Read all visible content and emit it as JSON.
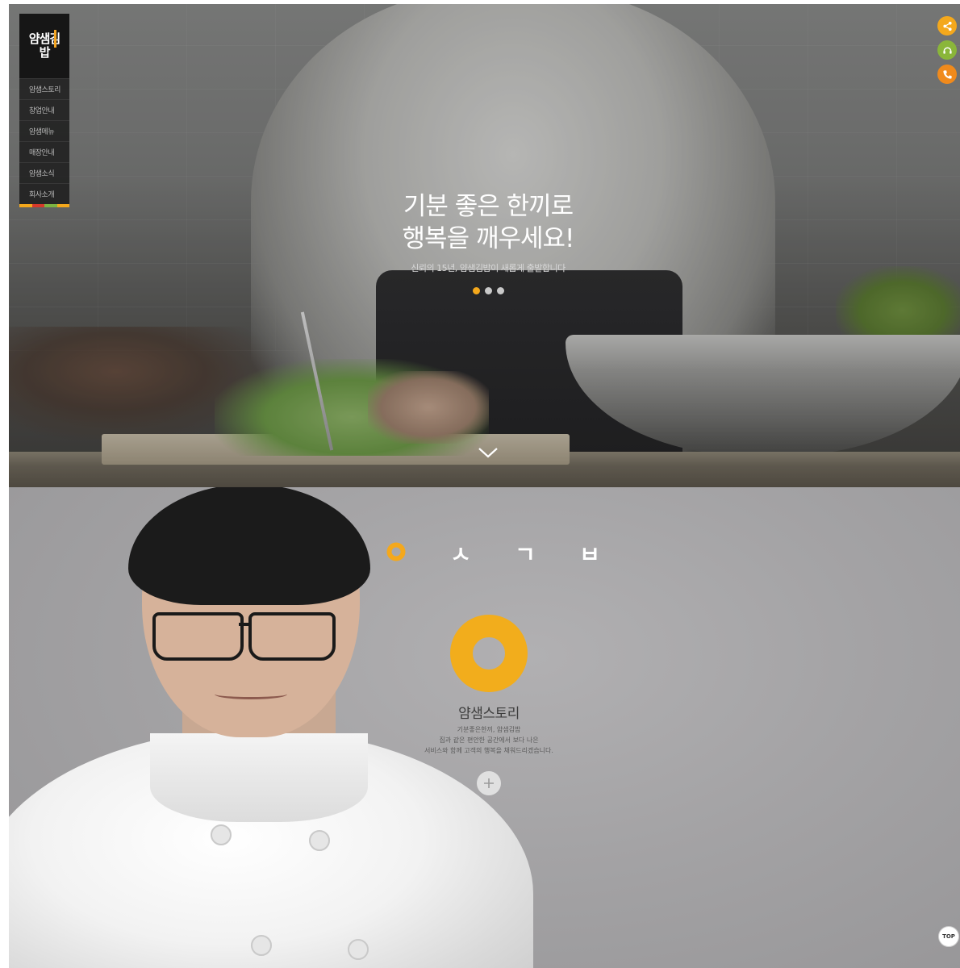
{
  "brand": {
    "logo_text": "얌샘김밥",
    "accent_color": "#f4a81c"
  },
  "nav": {
    "items": [
      {
        "label": "얌샘스토리"
      },
      {
        "label": "창업안내"
      },
      {
        "label": "얌샘메뉴"
      },
      {
        "label": "매장안내"
      },
      {
        "label": "얌샘소식"
      },
      {
        "label": "회사소개"
      }
    ],
    "stripe_colors": [
      "#f4a81c",
      "#d6392b",
      "#7cb342",
      "#f4a81c"
    ]
  },
  "quick_buttons": [
    {
      "icon": "share-icon",
      "color": "#f4a81c"
    },
    {
      "icon": "headset-icon",
      "color": "#8ab63a"
    },
    {
      "icon": "phone-icon",
      "color": "#f08a1c"
    }
  ],
  "hero": {
    "title_line1": "기분 좋은 한끼로",
    "title_line2": "행복을 깨우세요!",
    "subtitle": "신뢰의 15년, 얌샘김밥이 새롭게 출발합니다",
    "slide_count": 3,
    "active_slide": 1,
    "scroll_icon": "chevron-down-icon"
  },
  "story": {
    "letters": [
      "ㅇ",
      "ㅅ",
      "ㄱ",
      "ㅂ"
    ],
    "active_letter": 0,
    "title": "얌샘스토리",
    "desc_line1": "기분좋은한끼, 얌샘김밥",
    "desc_line2": "집과 같은 편안한 공간에서 보다 나은",
    "desc_line3": "서비스와 함께 고객의 행복을 채워드리겠습니다.",
    "more_icon": "plus-icon"
  },
  "top_button": {
    "label": "TOP"
  }
}
